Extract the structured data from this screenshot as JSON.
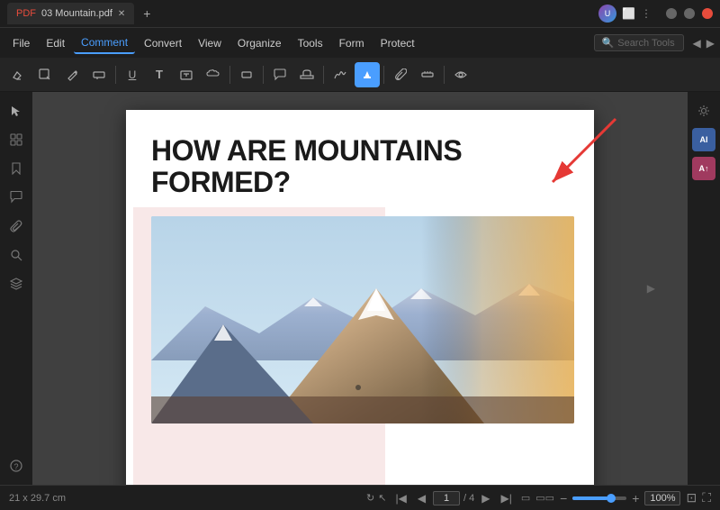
{
  "app": {
    "title": "03 Mountain.pdf",
    "tab_label": "03 Mountain.pdf"
  },
  "titlebar": {
    "avatar_initials": "U",
    "minimize": "─",
    "maximize": "□",
    "close": "✕"
  },
  "menubar": {
    "items": [
      {
        "id": "file",
        "label": "File"
      },
      {
        "id": "edit",
        "label": "Edit"
      },
      {
        "id": "comment",
        "label": "Comment",
        "active": true
      },
      {
        "id": "convert",
        "label": "Convert"
      },
      {
        "id": "view",
        "label": "View"
      },
      {
        "id": "organize",
        "label": "Organize"
      },
      {
        "id": "tools",
        "label": "Tools"
      },
      {
        "id": "form",
        "label": "Form"
      },
      {
        "id": "protect",
        "label": "Protect"
      }
    ],
    "search_placeholder": "Search Tools"
  },
  "toolbar": {
    "tools": [
      {
        "id": "eraser",
        "symbol": "⚬",
        "label": "eraser"
      },
      {
        "id": "sticky",
        "symbol": "⬛",
        "label": "sticky-note"
      },
      {
        "id": "pen",
        "symbol": "✏",
        "label": "pen"
      },
      {
        "id": "eraser2",
        "symbol": "◻",
        "label": "eraser2"
      },
      {
        "id": "underline",
        "symbol": "U̲",
        "label": "underline"
      },
      {
        "id": "text",
        "symbol": "T",
        "label": "text"
      },
      {
        "id": "textbox",
        "symbol": "⬜",
        "label": "text-box"
      },
      {
        "id": "cloud",
        "symbol": "☁",
        "label": "cloud"
      },
      {
        "id": "shape",
        "symbol": "▭",
        "label": "shape"
      },
      {
        "id": "comment",
        "symbol": "💬",
        "label": "comment"
      },
      {
        "id": "stamp",
        "symbol": "⊡",
        "label": "stamp"
      },
      {
        "id": "sign",
        "symbol": "✍",
        "label": "sign"
      },
      {
        "id": "highlight",
        "symbol": "✦",
        "label": "highlight-active",
        "active": true
      },
      {
        "id": "attach",
        "symbol": "📎",
        "label": "attachment"
      },
      {
        "id": "measure",
        "symbol": "📏",
        "label": "measure"
      },
      {
        "id": "eye",
        "symbol": "👁",
        "label": "eye"
      }
    ]
  },
  "left_sidebar": {
    "items": [
      {
        "id": "cursor",
        "symbol": "↖",
        "label": "cursor-tool"
      },
      {
        "id": "bookmark",
        "symbol": "🔖",
        "label": "bookmarks"
      },
      {
        "id": "comment-panel",
        "symbol": "💬",
        "label": "comments-panel"
      },
      {
        "id": "attachment",
        "symbol": "📎",
        "label": "attachments"
      },
      {
        "id": "search",
        "symbol": "🔍",
        "label": "search-panel"
      },
      {
        "id": "layers",
        "symbol": "⧉",
        "label": "layers"
      }
    ],
    "bottom_items": [
      {
        "id": "help",
        "symbol": "?",
        "label": "help"
      }
    ]
  },
  "right_panel": {
    "items": [
      {
        "id": "settings",
        "symbol": "⚙",
        "label": "properties-panel"
      },
      {
        "id": "ai1",
        "symbol": "AI",
        "label": "ai-assistant-1",
        "style": "blue"
      },
      {
        "id": "ai2",
        "symbol": "A↑",
        "label": "ai-assistant-2",
        "style": "red"
      }
    ]
  },
  "pdf": {
    "title": "HOW ARE MOUNTAINS FORMED?",
    "image_alt": "Mountain landscape photo"
  },
  "status_bar": {
    "dimensions": "21 x 29.7 cm",
    "page_current": "1",
    "page_total": "4",
    "page_display": "1 / 4",
    "zoom_percent": "100%"
  }
}
